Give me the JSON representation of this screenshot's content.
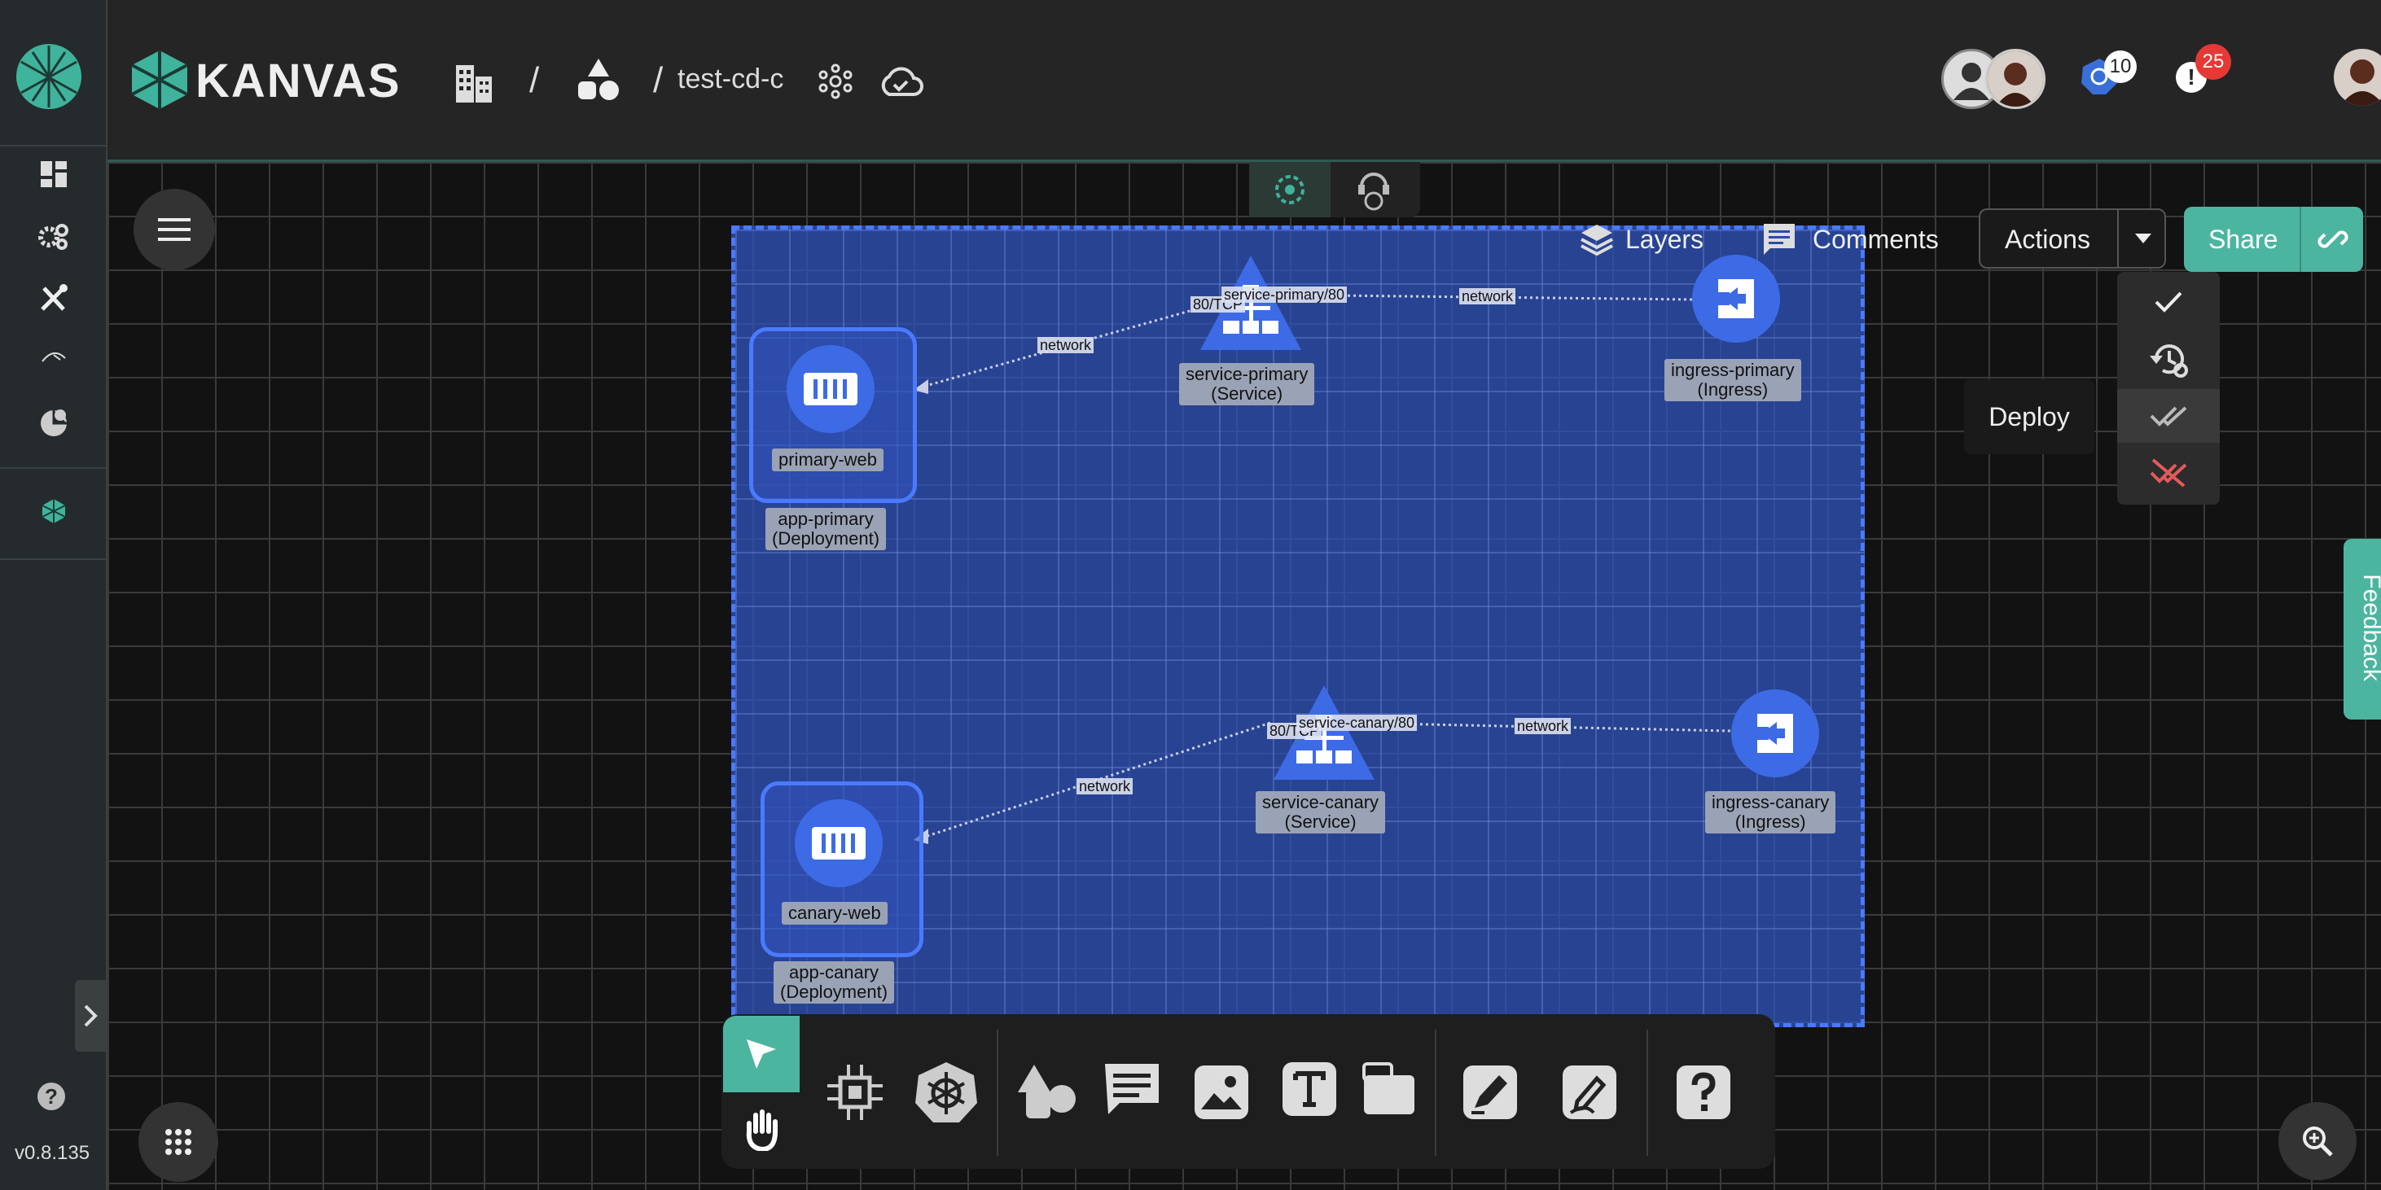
{
  "app": {
    "brand": "KANVAS",
    "version": "v0.8.135"
  },
  "breadcrumb": {
    "separator1": "/",
    "separator2": "/",
    "design_name": "test-cd-c"
  },
  "header": {
    "kubernetes_count": "10",
    "notifications_count": "25"
  },
  "canvas_toolbar": {
    "layers_label": "Layers",
    "comments_label": "Comments",
    "actions_label": "Actions",
    "share_label": "Share"
  },
  "deploy_tooltip": "Deploy",
  "feedback_label": "Feedback",
  "nodes": {
    "primary_web": "primary-web",
    "app_primary": "app-primary\n(Deployment)",
    "service_primary": "service-primary\n(Service)",
    "ingress_primary": "ingress-primary\n(Ingress)",
    "canary_web": "canary-web",
    "app_canary": "app-canary\n(Deployment)",
    "service_canary": "service-canary\n(Service)",
    "ingress_canary": "ingress-canary\n(Ingress)"
  },
  "edges": {
    "net1": "network",
    "net2": "network",
    "net3": "network",
    "net4": "network",
    "port_primary": "80/TCP",
    "svc_primary": "service-primary/80",
    "port_canary": "80/TCP",
    "svc_canary": "service-canary/80"
  },
  "colors": {
    "accent": "#4cb5a0",
    "node_blue": "#3d6be6",
    "group_fill": "#3054be",
    "badge_red": "#e53935"
  }
}
